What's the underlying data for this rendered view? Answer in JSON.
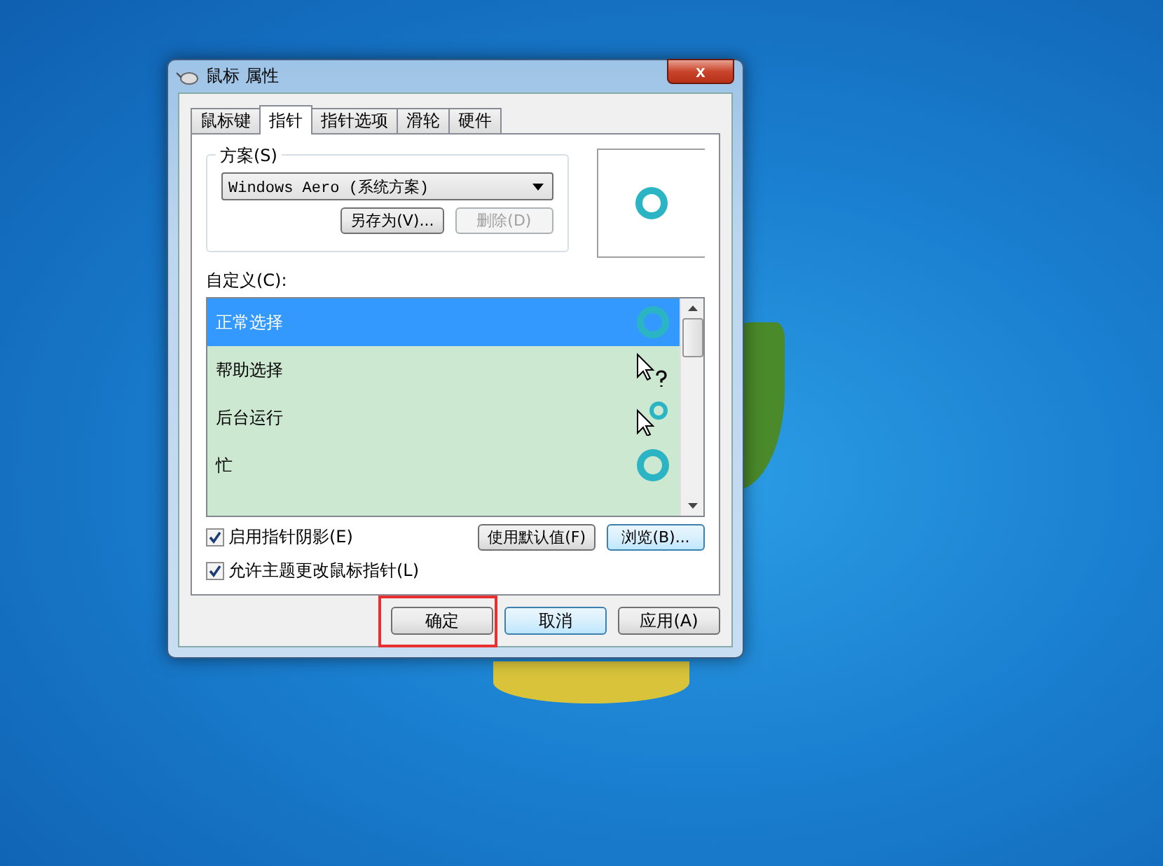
{
  "window": {
    "title": "鼠标 属性",
    "close": "x"
  },
  "tabs": [
    {
      "label": "鼠标键",
      "selected": false
    },
    {
      "label": "指针",
      "selected": true
    },
    {
      "label": "指针选项",
      "selected": false
    },
    {
      "label": "滑轮",
      "selected": false
    },
    {
      "label": "硬件",
      "selected": false
    }
  ],
  "scheme": {
    "label": "方案(S)",
    "value": "Windows Aero (系统方案)",
    "buttons": [
      {
        "label": "另存为(V)...",
        "disabled": false
      },
      {
        "label": "删除(D)",
        "disabled": true
      }
    ]
  },
  "customize": {
    "label": "自定义(C):",
    "items": [
      {
        "label": "正常选择",
        "kind": "ring",
        "selected": true
      },
      {
        "label": "帮助选择",
        "kind": "help",
        "selected": false
      },
      {
        "label": "后台运行",
        "kind": "working",
        "selected": false
      },
      {
        "label": "忙",
        "kind": "ring",
        "selected": false
      }
    ]
  },
  "options": [
    {
      "label": "启用指针阴影(E)",
      "checked": true
    },
    {
      "label": "允许主题更改鼠标指针(L)",
      "checked": true
    }
  ],
  "side_buttons": [
    {
      "label": "使用默认值(F)",
      "highlighted": false
    },
    {
      "label": "浏览(B)...",
      "highlighted": true
    }
  ],
  "footer_buttons": [
    {
      "label": "确定",
      "highlighted": false,
      "marked": true
    },
    {
      "label": "取消",
      "highlighted": true,
      "marked": false
    },
    {
      "label": "应用(A)",
      "highlighted": false,
      "marked": false
    }
  ]
}
